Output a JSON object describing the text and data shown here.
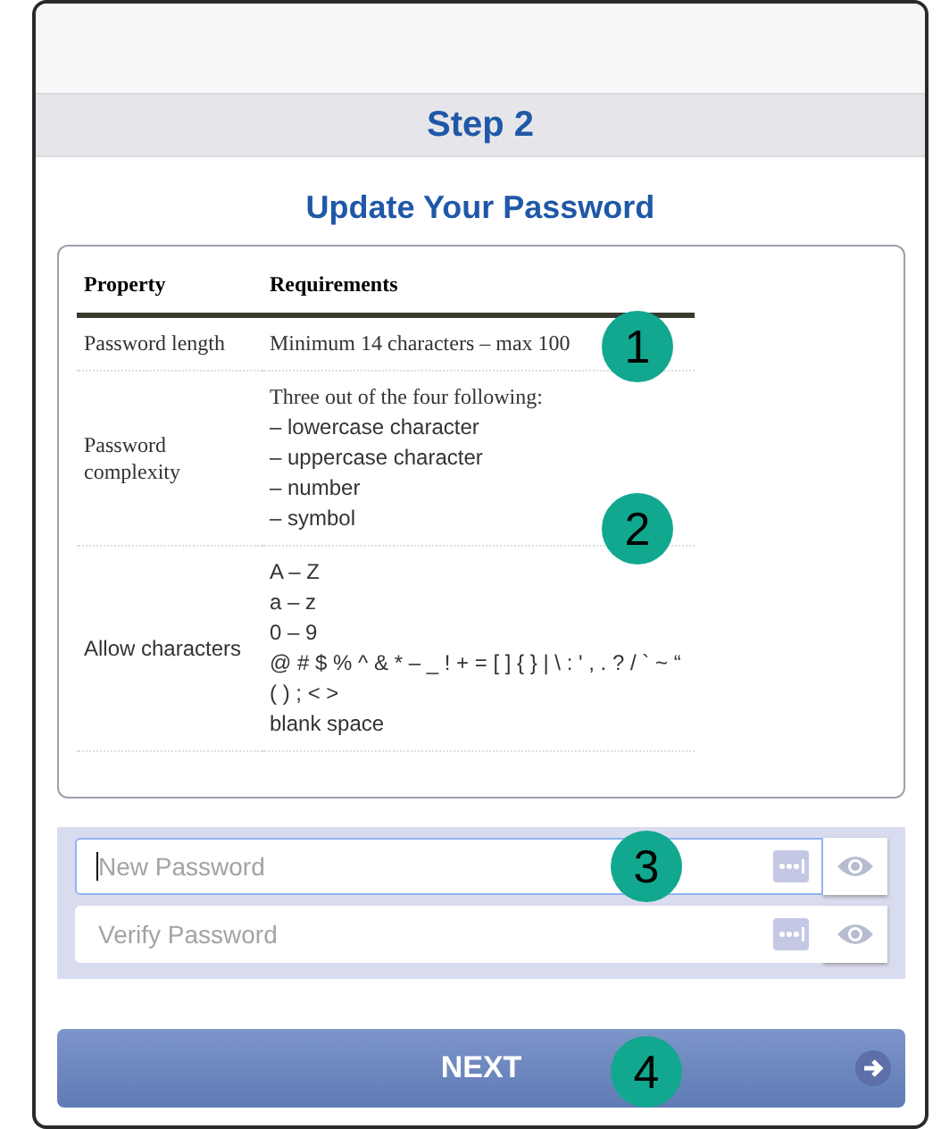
{
  "step": "Step 2",
  "title": "Update Your Password",
  "table": {
    "columns": [
      "Property",
      "Requirements"
    ],
    "rows": [
      {
        "property": "Password length",
        "requirements": [
          "Minimum 14 characters – max 100"
        ],
        "callout": "1"
      },
      {
        "property": "Password complexity",
        "requirements": [
          "Three out of the four following:",
          "– lowercase character",
          "– uppercase character",
          "– number",
          "– symbol"
        ],
        "callout": "2"
      },
      {
        "property": "Allow characters",
        "requirements": [
          "A – Z",
          "a – z",
          "0 – 9",
          "@ # $ % ^ & * – _ ! + = [ ] { } | \\ : ' , . ? / ` ~ “",
          "( ) ; < >",
          "blank space"
        ]
      }
    ]
  },
  "fields": [
    {
      "placeholder": "New Password",
      "focused": true,
      "callout": "3"
    },
    {
      "placeholder": "Verify Password",
      "focused": false
    }
  ],
  "next_button": {
    "label": "NEXT",
    "callout": "4"
  }
}
